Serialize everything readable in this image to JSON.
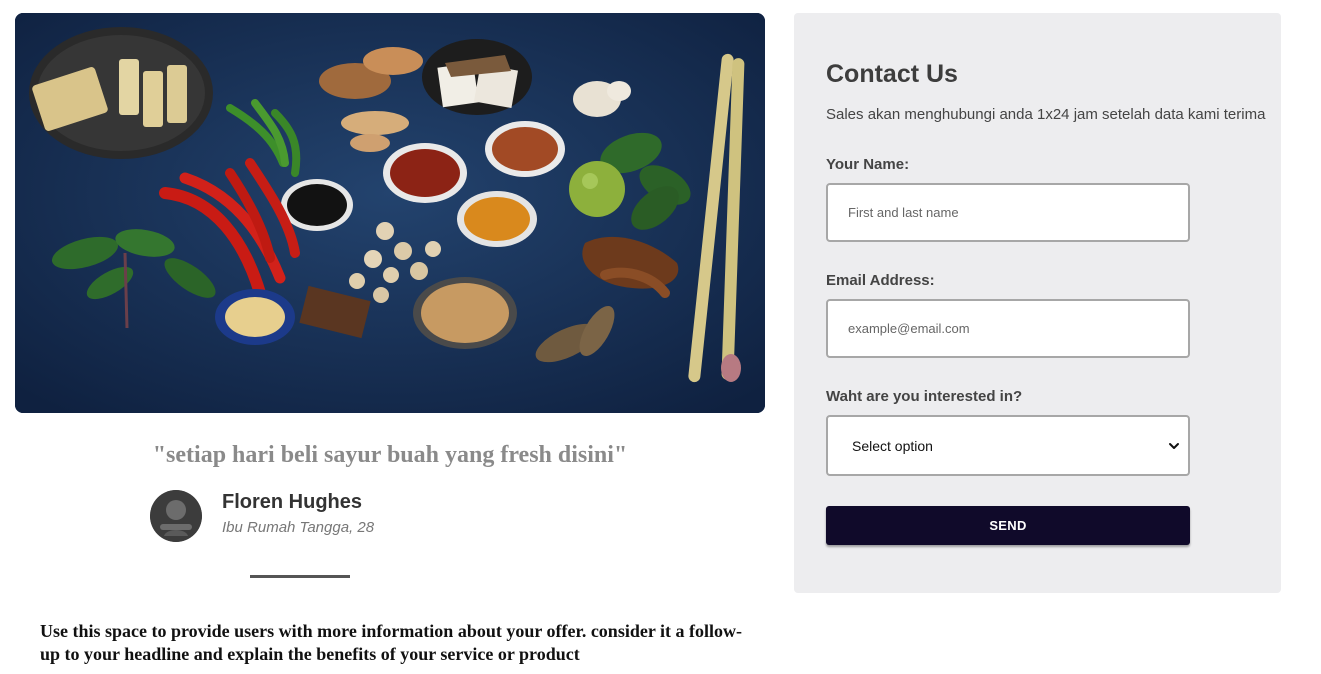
{
  "testimonial": {
    "quote": "\"setiap hari beli sayur buah yang fresh disini\"",
    "author_name": "Floren Hughes",
    "author_role": "Ibu Rumah Tangga, 28"
  },
  "info": {
    "text": "Use this space to provide users with more information about your offer. consider it a follow-up to your headline and explain the benefits of your service or product"
  },
  "contact": {
    "title": "Contact Us",
    "subtitle": "Sales akan menghubungi anda 1x24 jam setelah data kami terima",
    "name_label": "Your Name:",
    "name_placeholder": "First and last name",
    "email_label": "Email Address:",
    "email_placeholder": "example@email.com",
    "interest_label": "Waht are you interested in?",
    "interest_selected": "Select option",
    "send_label": "SEND"
  },
  "icons": {
    "avatar": "user-avatar-icon",
    "select": "chevron-down-icon"
  },
  "colors": {
    "panel_bg": "#ededef",
    "button_bg": "#100a2a",
    "quote_text": "#8a8a8a",
    "image_bg": "#14294a"
  }
}
